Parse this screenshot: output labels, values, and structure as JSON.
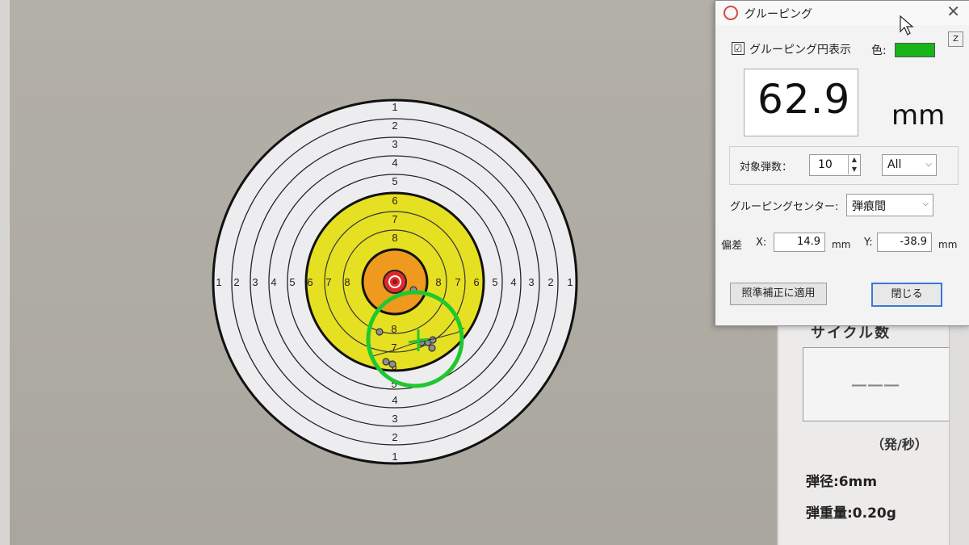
{
  "target": {
    "left_numbers": [
      "1",
      "2",
      "3",
      "4",
      "5",
      "6",
      "7",
      "8"
    ],
    "right_numbers": [
      "8",
      "7",
      "6",
      "5",
      "4",
      "3",
      "2",
      "1"
    ],
    "top_numbers": [
      "1",
      "2",
      "3",
      "4",
      "5",
      "6",
      "7",
      "8"
    ],
    "bottom_numbers": [
      "4",
      "3",
      "2",
      "1"
    ],
    "group_numbers": [
      "8",
      "7",
      "6",
      "5"
    ],
    "colors": {
      "paper": "#ededf0",
      "yellow": "#e6e022",
      "orange": "#ef9a1e",
      "red": "#e02a2a",
      "group_circle": "#20c830"
    }
  },
  "dialog": {
    "title": "グルーピング",
    "close_symbol": "✕",
    "z_label": "Z",
    "show_circle_label": "グルーピング円表示",
    "show_circle_checked": "☑",
    "color_label": "色:",
    "color_value": "#18b418",
    "group_size_value": "62.9",
    "group_size_unit": "mm",
    "shots_label": "対象弾数：",
    "shots_value": "10",
    "range_value": "All",
    "center_label": "グルーピングセンター:",
    "center_value": "弾痕間",
    "offset_label": "偏差",
    "x_label": "X:",
    "x_value": "14.9",
    "x_unit": "mm",
    "y_label": "Y:",
    "y_value": "-38.9",
    "y_unit": "mm",
    "apply_button": "照準補正に適用",
    "close_button": "閉じる"
  },
  "info_panel": {
    "cycle_title": "サイクル数",
    "cycle_value": "———",
    "cycle_unit": "（発/秒）",
    "bullet_diameter": "弾径:6mm",
    "bullet_weight": "弾重量:0.20g"
  }
}
